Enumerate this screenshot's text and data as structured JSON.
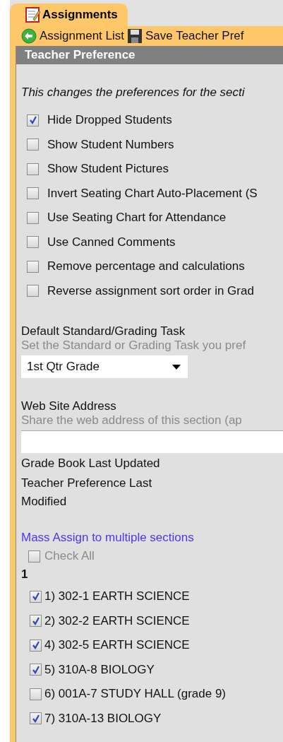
{
  "tab": {
    "label": "Assignments",
    "selected": true
  },
  "toolbar": [
    {
      "kind": "back",
      "label": "Assignment List"
    },
    {
      "kind": "save",
      "label": "Save Teacher Pref"
    }
  ],
  "panel": {
    "title": "Teacher Preference",
    "intro": "This changes the preferences for the secti",
    "preferences": [
      {
        "label": "Hide Dropped Students",
        "checked": true
      },
      {
        "label": "Show Student Numbers",
        "checked": false
      },
      {
        "label": "Show Student Pictures",
        "checked": false
      },
      {
        "label": "Invert Seating Chart Auto-Placement (S",
        "checked": false
      },
      {
        "label": "Use Seating Chart for Attendance",
        "checked": false
      },
      {
        "label": "Use Canned Comments",
        "checked": false
      },
      {
        "label": "Remove percentage and calculations",
        "checked": false
      },
      {
        "label": "Reverse assignment sort order in Grad",
        "checked": false
      }
    ],
    "default_task": {
      "label": "Default Standard/Grading Task",
      "hint": "Set the Standard or Grading Task you pref",
      "value": "1st Qtr Grade"
    },
    "website": {
      "label": "Web Site Address",
      "hint": "Share the web address of this section (ap"
    },
    "info": [
      "Grade Book Last Updated",
      "Teacher Preference Last Modified"
    ],
    "mass_assign": {
      "link": "Mass Assign to multiple sections",
      "check_all": {
        "label": "Check All",
        "checked": false,
        "disabled": true
      },
      "group": "1",
      "sections": [
        {
          "label": "1) 302-1 EARTH SCIENCE",
          "checked": true
        },
        {
          "label": "2) 302-2 EARTH SCIENCE",
          "checked": true
        },
        {
          "label": "4) 302-5 EARTH SCIENCE",
          "checked": true
        },
        {
          "label": "5) 310A-8 BIOLOGY",
          "checked": true
        },
        {
          "label": "6) 001A-7 STUDY HALL (grade 9)",
          "checked": false
        },
        {
          "label": "7) 310A-13 BIOLOGY",
          "checked": true
        }
      ]
    }
  }
}
